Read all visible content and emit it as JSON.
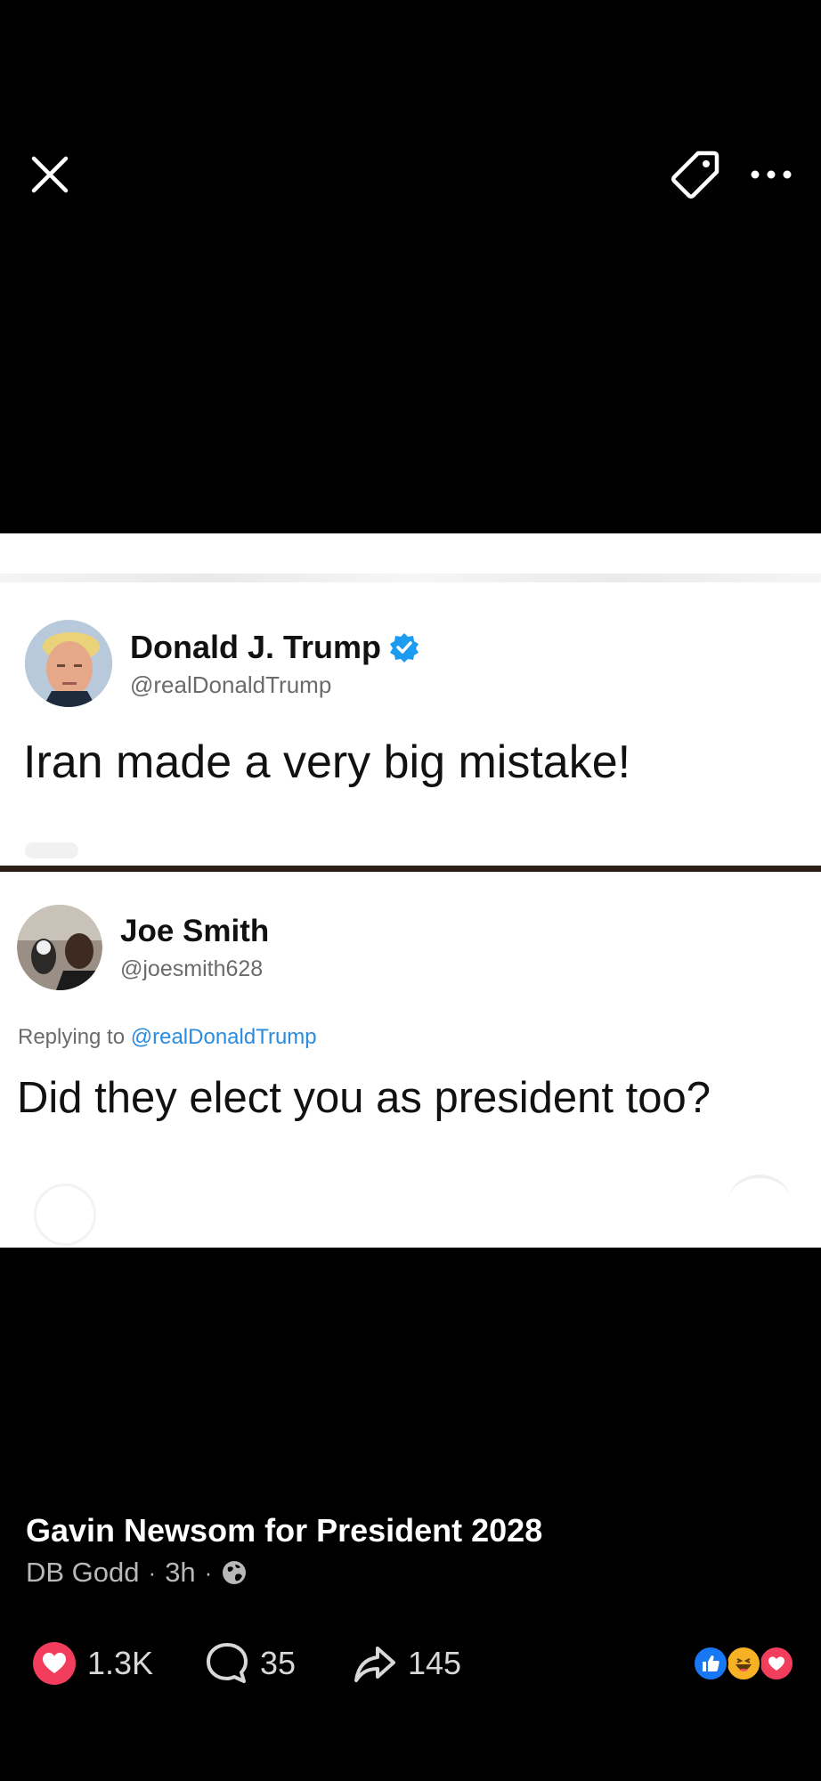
{
  "toolbar": {
    "close_icon": "close-icon",
    "tag_icon": "tag-icon",
    "more_icon": "more-horizontal-icon"
  },
  "photo": {
    "tweet": {
      "name": "Donald J. Trump",
      "handle": "@realDonaldTrump",
      "verified": true,
      "text": "Iran made a very big mistake!"
    },
    "reply": {
      "name": "Joe Smith",
      "handle": "@joesmith628",
      "replying_prefix": "Replying to",
      "replying_to": "@realDonaldTrump",
      "text": "Did they elect you as president too?"
    }
  },
  "post": {
    "title": "Gavin Newsom for President 2028",
    "author": "DB Godd",
    "time": "3h",
    "privacy_icon": "globe-icon"
  },
  "engagement": {
    "likes": "1.3K",
    "comments": "35",
    "shares": "145",
    "reactions": [
      "like",
      "haha",
      "love"
    ]
  },
  "colors": {
    "background": "#000000",
    "love": "#f23e5c",
    "like": "#1877f2",
    "haha": "#f7b125",
    "verified": "#1d9bf0"
  }
}
